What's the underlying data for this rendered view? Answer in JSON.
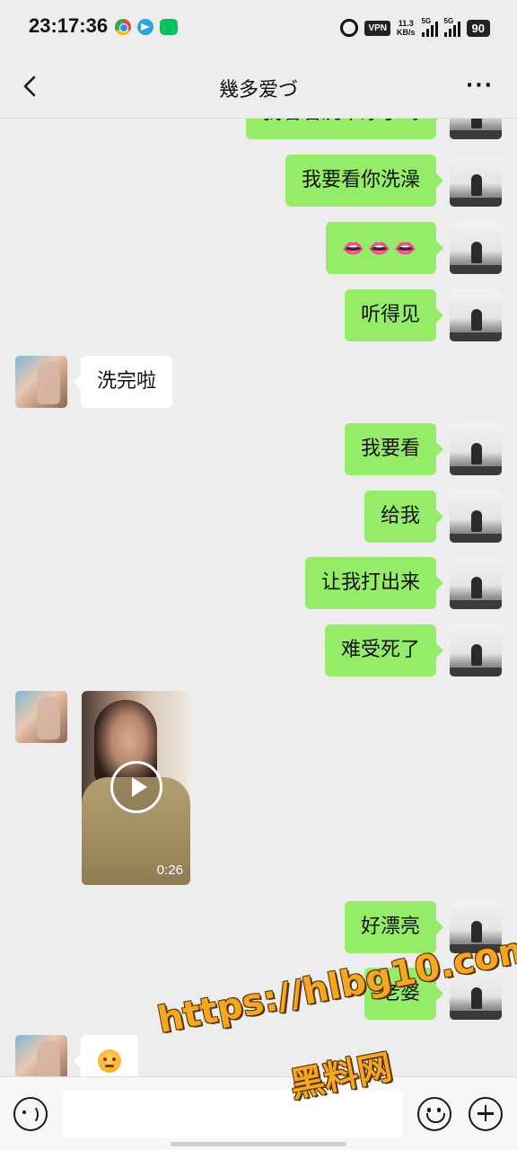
{
  "status_bar": {
    "time": "23:17:36",
    "app_icons": [
      "chrome-icon",
      "telegram-icon",
      "wechat-icon"
    ],
    "vpn": "VPN",
    "net_speed_value": "11.3",
    "net_speed_unit": "KB/s",
    "signal_1": "5G",
    "signal_2": "5G",
    "battery": "90"
  },
  "header": {
    "title": "幾多爱づ",
    "back_icon": "chevron-left-icon",
    "more_icon": "more-dots-icon",
    "more_label": "···"
  },
  "messages": [
    {
      "sender": "me",
      "text": "我看看洗干净了吗"
    },
    {
      "sender": "me",
      "text": "我要看你洗澡"
    },
    {
      "sender": "me",
      "text": "👄👄👄"
    },
    {
      "sender": "me",
      "text": "听得见"
    },
    {
      "sender": "her",
      "text": "洗完啦"
    },
    {
      "sender": "me",
      "text": "我要看"
    },
    {
      "sender": "me",
      "text": "给我"
    },
    {
      "sender": "me",
      "text": "让我打出来"
    },
    {
      "sender": "me",
      "text": "难受死了"
    },
    {
      "sender": "her",
      "type": "video",
      "duration": "0:26"
    },
    {
      "sender": "me",
      "text": "好漂亮"
    },
    {
      "sender": "me",
      "text": "老婆"
    },
    {
      "sender": "her",
      "type": "emoji",
      "emoji": "flushed-face-icon"
    }
  ],
  "watermark": {
    "url": "https://hlbg10.com",
    "name": "黑料网"
  },
  "input_bar": {
    "voice_icon": "voice-icon",
    "input_value": "",
    "emoji_icon": "emoji-icon",
    "plus_icon": "plus-icon"
  },
  "colors": {
    "background": "#ededed",
    "my_bubble": "#95ec69",
    "her_bubble": "#ffffff",
    "watermark": "#f5a623"
  }
}
